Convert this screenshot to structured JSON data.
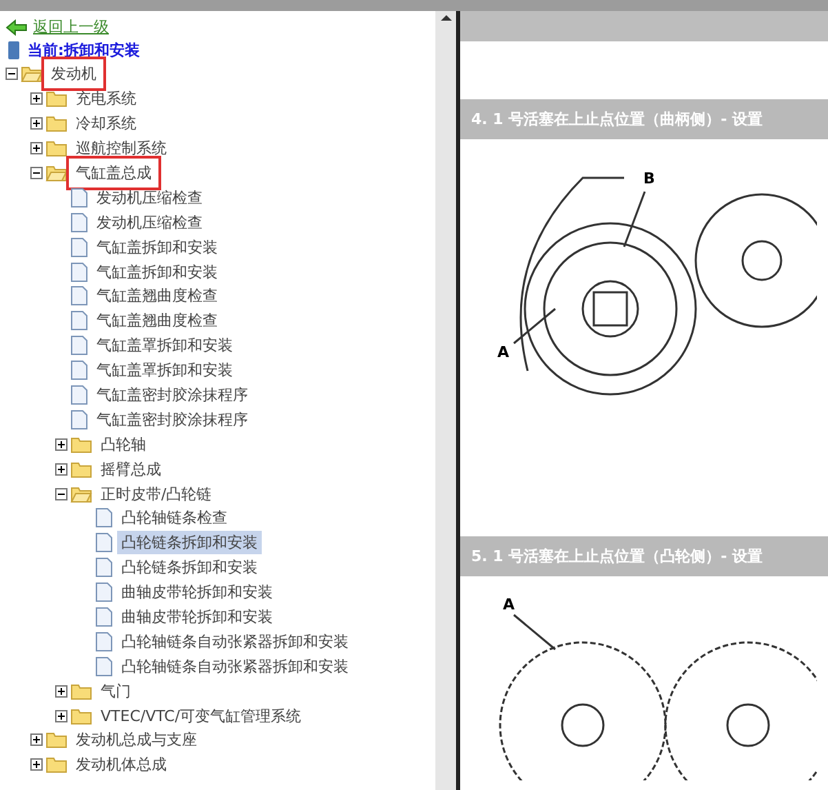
{
  "nav": {
    "back_link": "返回上一级",
    "current": "当前:拆卸和安装"
  },
  "tree": [
    {
      "label": "发动机",
      "kind": "folder",
      "expanded": true,
      "marked": true,
      "selected": false,
      "children": [
        {
          "label": "充电系统",
          "kind": "folder",
          "expanded": false,
          "marked": false,
          "selected": false
        },
        {
          "label": "冷却系统",
          "kind": "folder",
          "expanded": false,
          "marked": false,
          "selected": false
        },
        {
          "label": "巡航控制系统",
          "kind": "folder",
          "expanded": false,
          "marked": false,
          "selected": false
        },
        {
          "label": "气缸盖总成",
          "kind": "folder",
          "expanded": true,
          "marked": true,
          "selected": false,
          "children": [
            {
              "label": "发动机压缩检查",
              "kind": "page",
              "marked": false,
              "selected": false
            },
            {
              "label": "发动机压缩检查",
              "kind": "page",
              "marked": false,
              "selected": false
            },
            {
              "label": "气缸盖拆卸和安装",
              "kind": "page",
              "marked": false,
              "selected": false
            },
            {
              "label": "气缸盖拆卸和安装",
              "kind": "page",
              "marked": false,
              "selected": false
            },
            {
              "label": "气缸盖翘曲度检查",
              "kind": "page",
              "marked": false,
              "selected": false
            },
            {
              "label": "气缸盖翘曲度检查",
              "kind": "page",
              "marked": false,
              "selected": false
            },
            {
              "label": "气缸盖罩拆卸和安装",
              "kind": "page",
              "marked": false,
              "selected": false
            },
            {
              "label": "气缸盖罩拆卸和安装",
              "kind": "page",
              "marked": false,
              "selected": false
            },
            {
              "label": "气缸盖密封胶涂抹程序",
              "kind": "page",
              "marked": false,
              "selected": false
            },
            {
              "label": "气缸盖密封胶涂抹程序",
              "kind": "page",
              "marked": false,
              "selected": false
            },
            {
              "label": "凸轮轴",
              "kind": "folder",
              "expanded": false,
              "marked": false,
              "selected": false
            },
            {
              "label": "摇臂总成",
              "kind": "folder",
              "expanded": false,
              "marked": false,
              "selected": false
            },
            {
              "label": "正时皮带/凸轮链",
              "kind": "folder",
              "expanded": true,
              "marked": false,
              "selected": false,
              "children": [
                {
                  "label": "凸轮轴链条检查",
                  "kind": "page",
                  "marked": false,
                  "selected": false
                },
                {
                  "label": "凸轮链条拆卸和安装",
                  "kind": "page",
                  "marked": false,
                  "selected": true
                },
                {
                  "label": "凸轮链条拆卸和安装",
                  "kind": "page",
                  "marked": false,
                  "selected": false
                },
                {
                  "label": "曲轴皮带轮拆卸和安装",
                  "kind": "page",
                  "marked": false,
                  "selected": false
                },
                {
                  "label": "曲轴皮带轮拆卸和安装",
                  "kind": "page",
                  "marked": false,
                  "selected": false
                },
                {
                  "label": "凸轮轴链条自动张紧器拆卸和安装",
                  "kind": "page",
                  "marked": false,
                  "selected": false
                },
                {
                  "label": "凸轮轴链条自动张紧器拆卸和安装",
                  "kind": "page",
                  "marked": false,
                  "selected": false
                }
              ]
            },
            {
              "label": "气门",
              "kind": "folder",
              "expanded": false,
              "marked": false,
              "selected": false
            },
            {
              "label": "VTEC/VTC/可变气缸管理系统",
              "kind": "folder",
              "expanded": false,
              "marked": false,
              "selected": false
            }
          ]
        },
        {
          "label": "发动机总成与支座",
          "kind": "folder",
          "expanded": false,
          "marked": false,
          "selected": false
        },
        {
          "label": "发动机体总成",
          "kind": "folder",
          "expanded": false,
          "marked": false,
          "selected": false
        }
      ]
    }
  ],
  "sections": [
    {
      "heading": "4. 1 号活塞在上止点位置（曲柄侧）- 设置",
      "labels": [
        "B",
        "A"
      ],
      "kind": "crank"
    },
    {
      "heading": "5. 1 号活塞在上止点位置（凸轮侧）- 设置",
      "labels": [
        "A"
      ],
      "kind": "cam"
    }
  ]
}
